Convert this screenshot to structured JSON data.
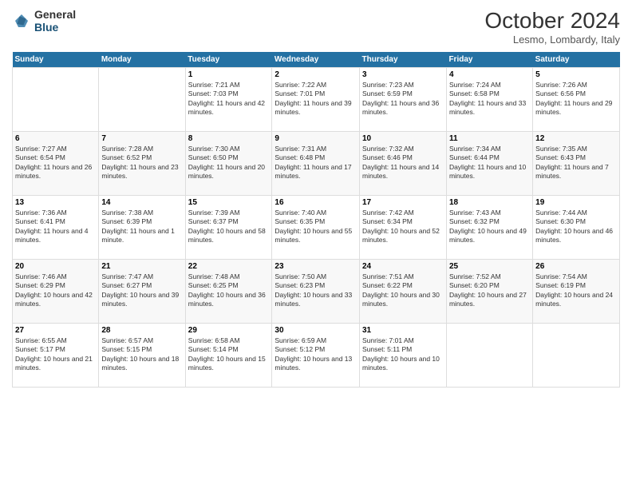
{
  "header": {
    "logo_general": "General",
    "logo_blue": "Blue",
    "title": "October 2024",
    "location": "Lesmo, Lombardy, Italy"
  },
  "weekdays": [
    "Sunday",
    "Monday",
    "Tuesday",
    "Wednesday",
    "Thursday",
    "Friday",
    "Saturday"
  ],
  "weeks": [
    [
      {
        "day": "",
        "info": ""
      },
      {
        "day": "",
        "info": ""
      },
      {
        "day": "1",
        "info": "Sunrise: 7:21 AM\nSunset: 7:03 PM\nDaylight: 11 hours and 42 minutes."
      },
      {
        "day": "2",
        "info": "Sunrise: 7:22 AM\nSunset: 7:01 PM\nDaylight: 11 hours and 39 minutes."
      },
      {
        "day": "3",
        "info": "Sunrise: 7:23 AM\nSunset: 6:59 PM\nDaylight: 11 hours and 36 minutes."
      },
      {
        "day": "4",
        "info": "Sunrise: 7:24 AM\nSunset: 6:58 PM\nDaylight: 11 hours and 33 minutes."
      },
      {
        "day": "5",
        "info": "Sunrise: 7:26 AM\nSunset: 6:56 PM\nDaylight: 11 hours and 29 minutes."
      }
    ],
    [
      {
        "day": "6",
        "info": "Sunrise: 7:27 AM\nSunset: 6:54 PM\nDaylight: 11 hours and 26 minutes."
      },
      {
        "day": "7",
        "info": "Sunrise: 7:28 AM\nSunset: 6:52 PM\nDaylight: 11 hours and 23 minutes."
      },
      {
        "day": "8",
        "info": "Sunrise: 7:30 AM\nSunset: 6:50 PM\nDaylight: 11 hours and 20 minutes."
      },
      {
        "day": "9",
        "info": "Sunrise: 7:31 AM\nSunset: 6:48 PM\nDaylight: 11 hours and 17 minutes."
      },
      {
        "day": "10",
        "info": "Sunrise: 7:32 AM\nSunset: 6:46 PM\nDaylight: 11 hours and 14 minutes."
      },
      {
        "day": "11",
        "info": "Sunrise: 7:34 AM\nSunset: 6:44 PM\nDaylight: 11 hours and 10 minutes."
      },
      {
        "day": "12",
        "info": "Sunrise: 7:35 AM\nSunset: 6:43 PM\nDaylight: 11 hours and 7 minutes."
      }
    ],
    [
      {
        "day": "13",
        "info": "Sunrise: 7:36 AM\nSunset: 6:41 PM\nDaylight: 11 hours and 4 minutes."
      },
      {
        "day": "14",
        "info": "Sunrise: 7:38 AM\nSunset: 6:39 PM\nDaylight: 11 hours and 1 minute."
      },
      {
        "day": "15",
        "info": "Sunrise: 7:39 AM\nSunset: 6:37 PM\nDaylight: 10 hours and 58 minutes."
      },
      {
        "day": "16",
        "info": "Sunrise: 7:40 AM\nSunset: 6:35 PM\nDaylight: 10 hours and 55 minutes."
      },
      {
        "day": "17",
        "info": "Sunrise: 7:42 AM\nSunset: 6:34 PM\nDaylight: 10 hours and 52 minutes."
      },
      {
        "day": "18",
        "info": "Sunrise: 7:43 AM\nSunset: 6:32 PM\nDaylight: 10 hours and 49 minutes."
      },
      {
        "day": "19",
        "info": "Sunrise: 7:44 AM\nSunset: 6:30 PM\nDaylight: 10 hours and 46 minutes."
      }
    ],
    [
      {
        "day": "20",
        "info": "Sunrise: 7:46 AM\nSunset: 6:29 PM\nDaylight: 10 hours and 42 minutes."
      },
      {
        "day": "21",
        "info": "Sunrise: 7:47 AM\nSunset: 6:27 PM\nDaylight: 10 hours and 39 minutes."
      },
      {
        "day": "22",
        "info": "Sunrise: 7:48 AM\nSunset: 6:25 PM\nDaylight: 10 hours and 36 minutes."
      },
      {
        "day": "23",
        "info": "Sunrise: 7:50 AM\nSunset: 6:23 PM\nDaylight: 10 hours and 33 minutes."
      },
      {
        "day": "24",
        "info": "Sunrise: 7:51 AM\nSunset: 6:22 PM\nDaylight: 10 hours and 30 minutes."
      },
      {
        "day": "25",
        "info": "Sunrise: 7:52 AM\nSunset: 6:20 PM\nDaylight: 10 hours and 27 minutes."
      },
      {
        "day": "26",
        "info": "Sunrise: 7:54 AM\nSunset: 6:19 PM\nDaylight: 10 hours and 24 minutes."
      }
    ],
    [
      {
        "day": "27",
        "info": "Sunrise: 6:55 AM\nSunset: 5:17 PM\nDaylight: 10 hours and 21 minutes."
      },
      {
        "day": "28",
        "info": "Sunrise: 6:57 AM\nSunset: 5:15 PM\nDaylight: 10 hours and 18 minutes."
      },
      {
        "day": "29",
        "info": "Sunrise: 6:58 AM\nSunset: 5:14 PM\nDaylight: 10 hours and 15 minutes."
      },
      {
        "day": "30",
        "info": "Sunrise: 6:59 AM\nSunset: 5:12 PM\nDaylight: 10 hours and 13 minutes."
      },
      {
        "day": "31",
        "info": "Sunrise: 7:01 AM\nSunset: 5:11 PM\nDaylight: 10 hours and 10 minutes."
      },
      {
        "day": "",
        "info": ""
      },
      {
        "day": "",
        "info": ""
      }
    ]
  ]
}
